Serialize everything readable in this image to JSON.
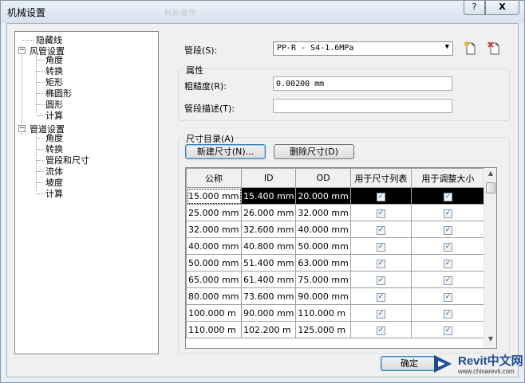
{
  "window": {
    "title": "机械设置",
    "ghost_title": "科拓福特"
  },
  "titlebar_buttons": {
    "help": "?",
    "close": "X"
  },
  "tree": {
    "items": [
      {
        "label": "隐藏线",
        "level": 0
      },
      {
        "label": "风管设置",
        "level": 0,
        "expander": "−"
      },
      {
        "label": "角度",
        "level": 1
      },
      {
        "label": "转换",
        "level": 1
      },
      {
        "label": "矩形",
        "level": 1
      },
      {
        "label": "椭圆形",
        "level": 1
      },
      {
        "label": "圆形",
        "level": 1
      },
      {
        "label": "计算",
        "level": 1
      },
      {
        "label": "管道设置",
        "level": 0,
        "expander": "−"
      },
      {
        "label": "角度",
        "level": 1
      },
      {
        "label": "转换",
        "level": 1
      },
      {
        "label": "管段和尺寸",
        "level": 1,
        "selected": true
      },
      {
        "label": "流体",
        "level": 1
      },
      {
        "label": "坡度",
        "level": 1
      },
      {
        "label": "计算",
        "level": 1
      }
    ]
  },
  "segment": {
    "label": "管段(S):",
    "value": "PP-R - S4-1.6MPa",
    "new_icon": "new-document-icon",
    "delete_icon": "delete-document-icon"
  },
  "properties": {
    "heading": "属性",
    "roughness_label": "粗糙度(R):",
    "roughness_value": "0.00200 mm",
    "description_label": "管段描述(T):",
    "description_value": ""
  },
  "sizes": {
    "heading": "尺寸目录(A)",
    "new_button": "新建尺寸(N)...",
    "delete_button": "删除尺寸(D)",
    "columns": [
      "公称",
      "ID",
      "OD",
      "用于尺寸列表",
      "用于调整大小"
    ],
    "rows": [
      [
        "15.000 mm",
        "15.400 mm",
        "20.000 mm",
        true,
        true
      ],
      [
        "25.000 mm",
        "26.000 mm",
        "32.000 mm",
        true,
        true
      ],
      [
        "32.000 mm",
        "32.600 mm",
        "40.000 mm",
        true,
        true
      ],
      [
        "40.000 mm",
        "40.800 mm",
        "50.000 mm",
        true,
        true
      ],
      [
        "50.000 mm",
        "51.400 mm",
        "63.000 mm",
        true,
        true
      ],
      [
        "65.000 mm",
        "61.400 mm",
        "75.000 mm",
        true,
        true
      ],
      [
        "80.000 mm",
        "73.600 mm",
        "90.000 mm",
        true,
        true
      ],
      [
        "100.000 m",
        "90.000 mm",
        "110.000 m",
        true,
        true
      ],
      [
        "110.000 m",
        "102.200 m",
        "125.000 m",
        true,
        true
      ]
    ]
  },
  "footer": {
    "ok_button": "确定"
  },
  "watermark": {
    "brand": "Revit中文网",
    "url": "www.chinarevit.com"
  },
  "colors": {
    "selection": "#000000",
    "accent": "#1f4c8f"
  }
}
